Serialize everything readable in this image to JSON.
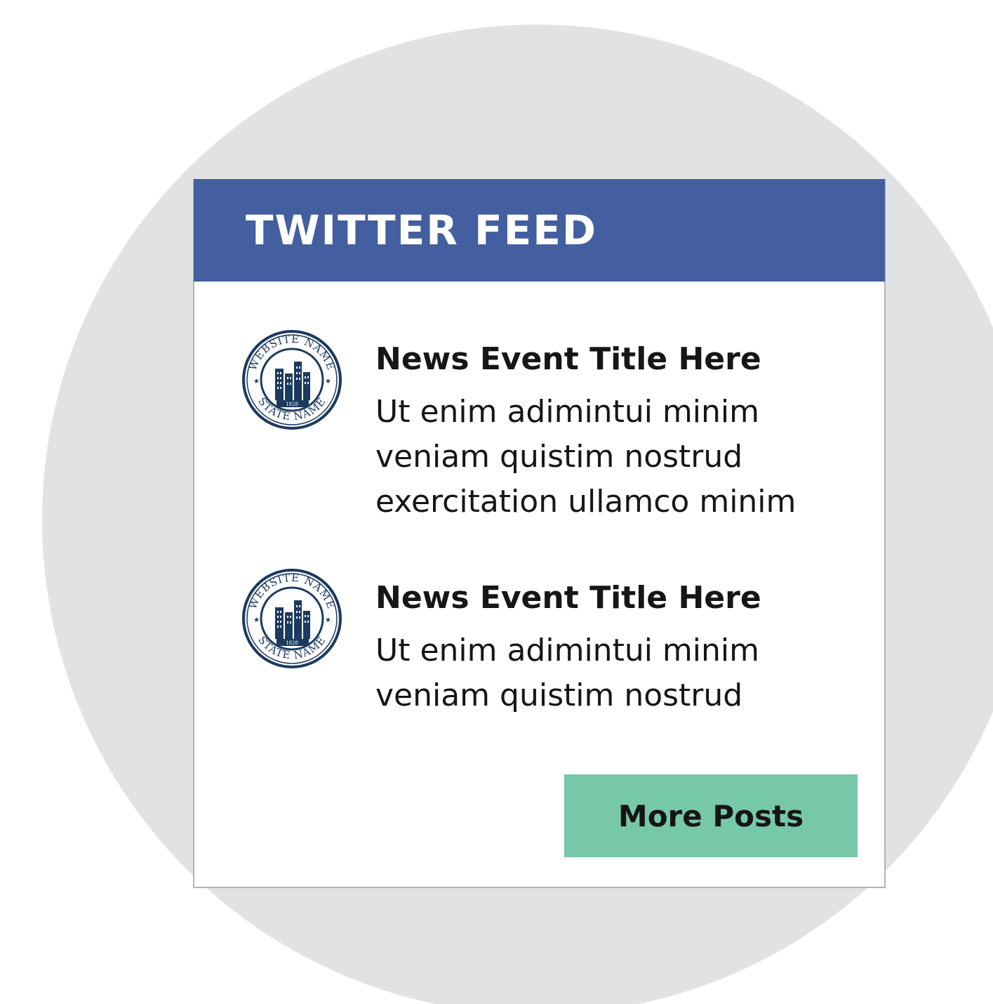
{
  "widget": {
    "title": "TWITTER FEED",
    "more_button_label": "More Posts"
  },
  "seal": {
    "top_text": "WEBSITE NAME",
    "bottom_text": "STATE NAME",
    "year": "1828",
    "color": "#1b3a5e"
  },
  "posts": [
    {
      "title": "News Event Title Here",
      "body_lines": [
        "Ut enim adimintui minim",
        "veniam quistim nostrud",
        "exercitation ullamco minim"
      ]
    },
    {
      "title": "News Event Title Here",
      "body_lines": [
        "Ut enim adimintui minim",
        "veniam quistim nostrud"
      ]
    }
  ],
  "colors": {
    "background_circle": "#e1e2e4",
    "header": "#445f9f",
    "button": "#77c8a9",
    "card_border": "#b3b3b3"
  }
}
